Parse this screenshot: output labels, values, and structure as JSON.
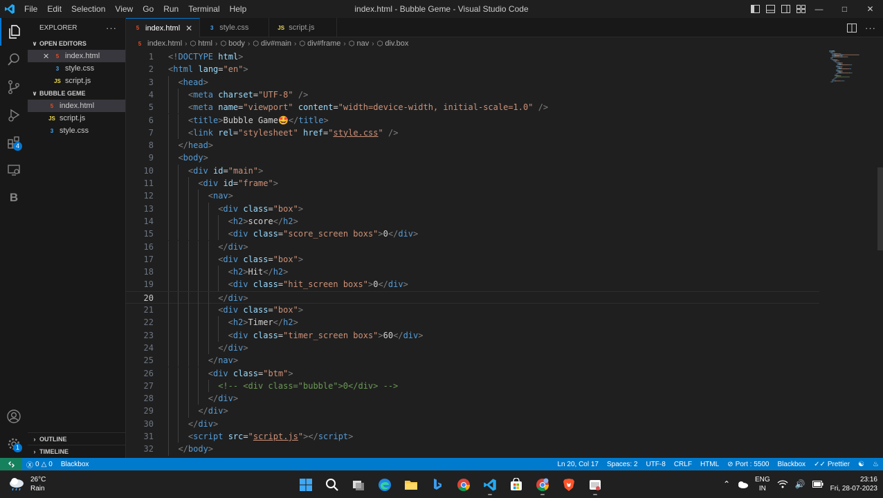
{
  "titlebar": {
    "menu": [
      "File",
      "Edit",
      "Selection",
      "View",
      "Go",
      "Run",
      "Terminal",
      "Help"
    ],
    "window_title": "index.html - Bubble Geme - Visual Studio Code"
  },
  "activitybar": {
    "extensions_badge": "4",
    "settings_badge": "1",
    "blackbox_letter": "B"
  },
  "sidebar": {
    "title": "EXPLORER",
    "open_editors_label": "OPEN EDITORS",
    "open_editors": [
      {
        "name": "index.html",
        "type": "html"
      },
      {
        "name": "style.css",
        "type": "css"
      },
      {
        "name": "script.js",
        "type": "js"
      }
    ],
    "folder_label": "BUBBLE GEME",
    "files": [
      {
        "name": "index.html",
        "type": "html"
      },
      {
        "name": "script.js",
        "type": "js"
      },
      {
        "name": "style.css",
        "type": "css"
      }
    ],
    "outline_label": "OUTLINE",
    "timeline_label": "TIMELINE"
  },
  "tabs": [
    {
      "label": "index.html",
      "type": "html",
      "active": true
    },
    {
      "label": "style.css",
      "type": "css",
      "active": false
    },
    {
      "label": "script.js",
      "type": "js",
      "active": false
    }
  ],
  "file_icon_labels": {
    "html": "5",
    "css": "3",
    "js": "JS"
  },
  "breadcrumb": [
    "index.html",
    "html",
    "body",
    "div#main",
    "div#frame",
    "nav",
    "div.box"
  ],
  "editor": {
    "current_line": 20,
    "lines": [
      {
        "n": "1",
        "indent": 0,
        "tokens": [
          [
            "p",
            "<!"
          ],
          [
            "t",
            "DOCTYPE"
          ],
          [
            "tx",
            " "
          ],
          [
            "a",
            "html"
          ],
          [
            "p",
            ">"
          ]
        ]
      },
      {
        "n": "2",
        "indent": 0,
        "tokens": [
          [
            "p",
            "<"
          ],
          [
            "t",
            "html"
          ],
          [
            "tx",
            " "
          ],
          [
            "a",
            "lang"
          ],
          [
            "tx",
            "="
          ],
          [
            "s",
            "\"en\""
          ],
          [
            "p",
            ">"
          ]
        ]
      },
      {
        "n": "3",
        "indent": 1,
        "tokens": [
          [
            "p",
            "<"
          ],
          [
            "t",
            "head"
          ],
          [
            "p",
            ">"
          ]
        ]
      },
      {
        "n": "4",
        "indent": 2,
        "tokens": [
          [
            "p",
            "<"
          ],
          [
            "t",
            "meta"
          ],
          [
            "tx",
            " "
          ],
          [
            "a",
            "charset"
          ],
          [
            "tx",
            "="
          ],
          [
            "s",
            "\"UTF-8\""
          ],
          [
            "tx",
            " "
          ],
          [
            "p",
            "/>"
          ]
        ]
      },
      {
        "n": "5",
        "indent": 2,
        "tokens": [
          [
            "p",
            "<"
          ],
          [
            "t",
            "meta"
          ],
          [
            "tx",
            " "
          ],
          [
            "a",
            "name"
          ],
          [
            "tx",
            "="
          ],
          [
            "s",
            "\"viewport\""
          ],
          [
            "tx",
            " "
          ],
          [
            "a",
            "content"
          ],
          [
            "tx",
            "="
          ],
          [
            "s",
            "\"width=device-width, initial-scale=1.0\""
          ],
          [
            "tx",
            " "
          ],
          [
            "p",
            "/>"
          ]
        ]
      },
      {
        "n": "6",
        "indent": 2,
        "tokens": [
          [
            "p",
            "<"
          ],
          [
            "t",
            "title"
          ],
          [
            "p",
            ">"
          ],
          [
            "tx",
            "Bubble Game🤩"
          ],
          [
            "p",
            "</"
          ],
          [
            "t",
            "title"
          ],
          [
            "p",
            ">"
          ]
        ]
      },
      {
        "n": "7",
        "indent": 2,
        "tokens": [
          [
            "p",
            "<"
          ],
          [
            "t",
            "link"
          ],
          [
            "tx",
            " "
          ],
          [
            "a",
            "rel"
          ],
          [
            "tx",
            "="
          ],
          [
            "s",
            "\"stylesheet\""
          ],
          [
            "tx",
            " "
          ],
          [
            "a",
            "href"
          ],
          [
            "tx",
            "="
          ],
          [
            "s",
            "\""
          ],
          [
            "sl",
            "style.css"
          ],
          [
            "s",
            "\""
          ],
          [
            "tx",
            " "
          ],
          [
            "p",
            "/>"
          ]
        ]
      },
      {
        "n": "8",
        "indent": 1,
        "tokens": [
          [
            "p",
            "</"
          ],
          [
            "t",
            "head"
          ],
          [
            "p",
            ">"
          ]
        ]
      },
      {
        "n": "9",
        "indent": 1,
        "tokens": [
          [
            "p",
            "<"
          ],
          [
            "t",
            "body"
          ],
          [
            "p",
            ">"
          ]
        ]
      },
      {
        "n": "10",
        "indent": 2,
        "tokens": [
          [
            "p",
            "<"
          ],
          [
            "t",
            "div"
          ],
          [
            "tx",
            " "
          ],
          [
            "a",
            "id"
          ],
          [
            "tx",
            "="
          ],
          [
            "s",
            "\"main\""
          ],
          [
            "p",
            ">"
          ]
        ]
      },
      {
        "n": "11",
        "indent": 3,
        "tokens": [
          [
            "p",
            "<"
          ],
          [
            "t",
            "div"
          ],
          [
            "tx",
            " "
          ],
          [
            "a",
            "id"
          ],
          [
            "tx",
            "="
          ],
          [
            "s",
            "\"frame\""
          ],
          [
            "p",
            ">"
          ]
        ]
      },
      {
        "n": "12",
        "indent": 4,
        "tokens": [
          [
            "p",
            "<"
          ],
          [
            "t",
            "nav"
          ],
          [
            "p",
            ">"
          ]
        ]
      },
      {
        "n": "13",
        "indent": 5,
        "tokens": [
          [
            "p",
            "<"
          ],
          [
            "t",
            "div"
          ],
          [
            "tx",
            " "
          ],
          [
            "a",
            "class"
          ],
          [
            "tx",
            "="
          ],
          [
            "s",
            "\"box\""
          ],
          [
            "p",
            ">"
          ]
        ]
      },
      {
        "n": "14",
        "indent": 6,
        "tokens": [
          [
            "p",
            "<"
          ],
          [
            "t",
            "h2"
          ],
          [
            "p",
            ">"
          ],
          [
            "tx",
            "score"
          ],
          [
            "p",
            "</"
          ],
          [
            "t",
            "h2"
          ],
          [
            "p",
            ">"
          ]
        ]
      },
      {
        "n": "15",
        "indent": 6,
        "tokens": [
          [
            "p",
            "<"
          ],
          [
            "t",
            "div"
          ],
          [
            "tx",
            " "
          ],
          [
            "a",
            "class"
          ],
          [
            "tx",
            "="
          ],
          [
            "s",
            "\"score_screen boxs\""
          ],
          [
            "p",
            ">"
          ],
          [
            "tx",
            "0"
          ],
          [
            "p",
            "</"
          ],
          [
            "t",
            "div"
          ],
          [
            "p",
            ">"
          ]
        ]
      },
      {
        "n": "16",
        "indent": 5,
        "tokens": [
          [
            "p",
            "</"
          ],
          [
            "t",
            "div"
          ],
          [
            "p",
            ">"
          ]
        ]
      },
      {
        "n": "17",
        "indent": 5,
        "tokens": [
          [
            "p",
            "<"
          ],
          [
            "t",
            "div"
          ],
          [
            "tx",
            " "
          ],
          [
            "a",
            "class"
          ],
          [
            "tx",
            "="
          ],
          [
            "s",
            "\"box\""
          ],
          [
            "p",
            ">"
          ]
        ]
      },
      {
        "n": "18",
        "indent": 6,
        "tokens": [
          [
            "p",
            "<"
          ],
          [
            "t",
            "h2"
          ],
          [
            "p",
            ">"
          ],
          [
            "tx",
            "Hit"
          ],
          [
            "p",
            "</"
          ],
          [
            "t",
            "h2"
          ],
          [
            "p",
            ">"
          ]
        ]
      },
      {
        "n": "19",
        "indent": 6,
        "tokens": [
          [
            "p",
            "<"
          ],
          [
            "t",
            "div"
          ],
          [
            "tx",
            " "
          ],
          [
            "a",
            "class"
          ],
          [
            "tx",
            "="
          ],
          [
            "s",
            "\"hit_screen boxs\""
          ],
          [
            "p",
            ">"
          ],
          [
            "tx",
            "0"
          ],
          [
            "p",
            "</"
          ],
          [
            "t",
            "div"
          ],
          [
            "p",
            ">"
          ]
        ]
      },
      {
        "n": "20",
        "indent": 5,
        "tokens": [
          [
            "p",
            "</"
          ],
          [
            "t",
            "div"
          ],
          [
            "p",
            ">"
          ]
        ]
      },
      {
        "n": "21",
        "indent": 5,
        "tokens": [
          [
            "p",
            "<"
          ],
          [
            "t",
            "div"
          ],
          [
            "tx",
            " "
          ],
          [
            "a",
            "class"
          ],
          [
            "tx",
            "="
          ],
          [
            "s",
            "\"box\""
          ],
          [
            "p",
            ">"
          ]
        ]
      },
      {
        "n": "22",
        "indent": 6,
        "tokens": [
          [
            "p",
            "<"
          ],
          [
            "t",
            "h2"
          ],
          [
            "p",
            ">"
          ],
          [
            "tx",
            "Timer"
          ],
          [
            "p",
            "</"
          ],
          [
            "t",
            "h2"
          ],
          [
            "p",
            ">"
          ]
        ]
      },
      {
        "n": "23",
        "indent": 6,
        "tokens": [
          [
            "p",
            "<"
          ],
          [
            "t",
            "div"
          ],
          [
            "tx",
            " "
          ],
          [
            "a",
            "class"
          ],
          [
            "tx",
            "="
          ],
          [
            "s",
            "\"timer_screen boxs\""
          ],
          [
            "p",
            ">"
          ],
          [
            "tx",
            "60"
          ],
          [
            "p",
            "</"
          ],
          [
            "t",
            "div"
          ],
          [
            "p",
            ">"
          ]
        ]
      },
      {
        "n": "24",
        "indent": 5,
        "tokens": [
          [
            "p",
            "</"
          ],
          [
            "t",
            "div"
          ],
          [
            "p",
            ">"
          ]
        ]
      },
      {
        "n": "25",
        "indent": 4,
        "tokens": [
          [
            "p",
            "</"
          ],
          [
            "t",
            "nav"
          ],
          [
            "p",
            ">"
          ]
        ]
      },
      {
        "n": "26",
        "indent": 4,
        "tokens": [
          [
            "p",
            "<"
          ],
          [
            "t",
            "div"
          ],
          [
            "tx",
            " "
          ],
          [
            "a",
            "class"
          ],
          [
            "tx",
            "="
          ],
          [
            "s",
            "\"btm\""
          ],
          [
            "p",
            ">"
          ]
        ]
      },
      {
        "n": "27",
        "indent": 5,
        "tokens": [
          [
            "c",
            "<!-- <div class=\"bubble\">0</div> -->"
          ]
        ]
      },
      {
        "n": "28",
        "indent": 4,
        "tokens": [
          [
            "p",
            "</"
          ],
          [
            "t",
            "div"
          ],
          [
            "p",
            ">"
          ]
        ]
      },
      {
        "n": "29",
        "indent": 3,
        "tokens": [
          [
            "p",
            "</"
          ],
          [
            "t",
            "div"
          ],
          [
            "p",
            ">"
          ]
        ]
      },
      {
        "n": "30",
        "indent": 2,
        "tokens": [
          [
            "p",
            "</"
          ],
          [
            "t",
            "div"
          ],
          [
            "p",
            ">"
          ]
        ]
      },
      {
        "n": "31",
        "indent": 2,
        "tokens": [
          [
            "p",
            "<"
          ],
          [
            "t",
            "script"
          ],
          [
            "tx",
            " "
          ],
          [
            "a",
            "src"
          ],
          [
            "tx",
            "="
          ],
          [
            "s",
            "\""
          ],
          [
            "sl",
            "script.js"
          ],
          [
            "s",
            "\""
          ],
          [
            "p",
            "></"
          ],
          [
            "t",
            "script"
          ],
          [
            "p",
            ">"
          ]
        ]
      },
      {
        "n": "32",
        "indent": 1,
        "tokens": [
          [
            "p",
            "</"
          ],
          [
            "t",
            "body"
          ],
          [
            "p",
            ">"
          ]
        ]
      }
    ]
  },
  "statusbar": {
    "errors": "0",
    "warnings": "0",
    "blackbox_left": "Blackbox",
    "position": "Ln 20, Col 17",
    "spaces": "Spaces: 2",
    "encoding": "UTF-8",
    "eol": "CRLF",
    "language": "HTML",
    "port": "Port : 5500",
    "blackbox_right": "Blackbox",
    "prettier": "Prettier"
  },
  "taskbar": {
    "temperature": "26°C",
    "condition": "Rain",
    "lang_top": "ENG",
    "lang_bottom": "IN",
    "time": "23:16",
    "date": "Fri, 28-07-2023"
  },
  "colors": {
    "accent": "#0078d4",
    "statusbar": "#007acc",
    "remote": "#16825d",
    "html_icon": "#e44d26",
    "css_icon": "#42a5f5",
    "js_icon": "#f0db4f"
  }
}
